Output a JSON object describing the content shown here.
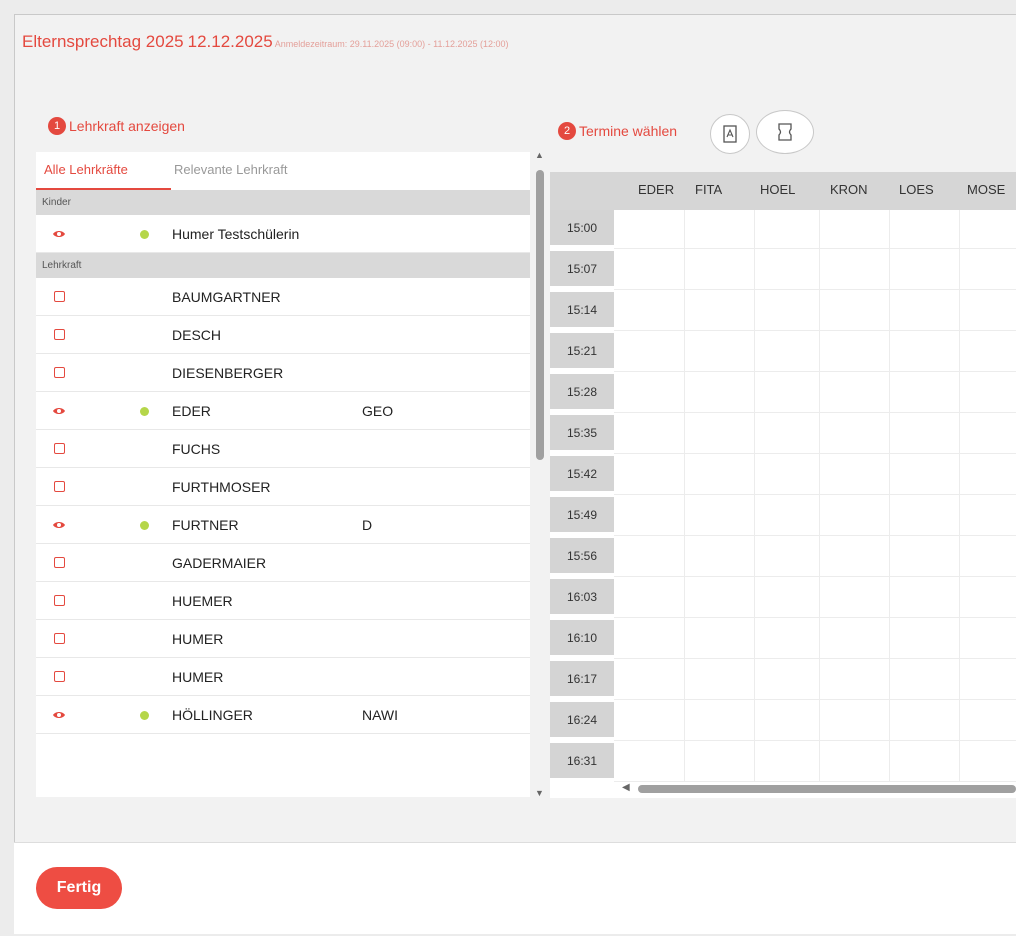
{
  "header": {
    "title": "Elternsprechtag 2025",
    "date": "12.12.2025",
    "period": "Anmeldezeitraum: 29.11.2025 (09:00) - 11.12.2025 (12:00)"
  },
  "step1": {
    "number": "1",
    "label": "Lehrkraft anzeigen"
  },
  "step2": {
    "number": "2",
    "label": "Termine wählen"
  },
  "tabs": [
    {
      "label": "Alle Lehrkräfte",
      "active": true
    },
    {
      "label": "Relevante Lehrkraft",
      "active": false
    }
  ],
  "sections": {
    "children_label": "Kinder",
    "teachers_label": "Lehrkraft"
  },
  "children": [
    {
      "name": "Humer Testschülerin",
      "visible": true,
      "online": true,
      "subject": ""
    }
  ],
  "teachers": [
    {
      "name": "BAUMGARTNER",
      "visible": false,
      "online": false,
      "subject": ""
    },
    {
      "name": "DESCH",
      "visible": false,
      "online": false,
      "subject": ""
    },
    {
      "name": "DIESENBERGER",
      "visible": false,
      "online": false,
      "subject": ""
    },
    {
      "name": "EDER",
      "visible": true,
      "online": true,
      "subject": "GEO"
    },
    {
      "name": "FUCHS",
      "visible": false,
      "online": false,
      "subject": ""
    },
    {
      "name": "FURTHMOSER",
      "visible": false,
      "online": false,
      "subject": ""
    },
    {
      "name": "FURTNER",
      "visible": true,
      "online": true,
      "subject": "D"
    },
    {
      "name": "GADERMAIER",
      "visible": false,
      "online": false,
      "subject": ""
    },
    {
      "name": "HUEMER",
      "visible": false,
      "online": false,
      "subject": ""
    },
    {
      "name": "HUMER",
      "visible": false,
      "online": false,
      "subject": ""
    },
    {
      "name": "HUMER",
      "visible": false,
      "online": false,
      "subject": ""
    },
    {
      "name": "HÖLLINGER",
      "visible": true,
      "online": true,
      "subject": "NAWI"
    }
  ],
  "schedule": {
    "columns": [
      "EDER",
      "FITA",
      "HOEL",
      "KRON",
      "LOES",
      "MOSE"
    ],
    "times": [
      "15:00",
      "15:07",
      "15:14",
      "15:21",
      "15:28",
      "15:35",
      "15:42",
      "15:49",
      "15:56",
      "16:03",
      "16:10",
      "16:17",
      "16:24",
      "16:31"
    ]
  },
  "icons": {
    "pdf": "pdf-icon",
    "print": "print-icon",
    "visible": "eye-icon",
    "hidden": "checkbox-icon",
    "online": "status-dot-icon"
  },
  "colors": {
    "accent": "#e4493f",
    "online": "#b5d64a",
    "button": "#ee4d43"
  },
  "footer": {
    "done_label": "Fertig"
  }
}
